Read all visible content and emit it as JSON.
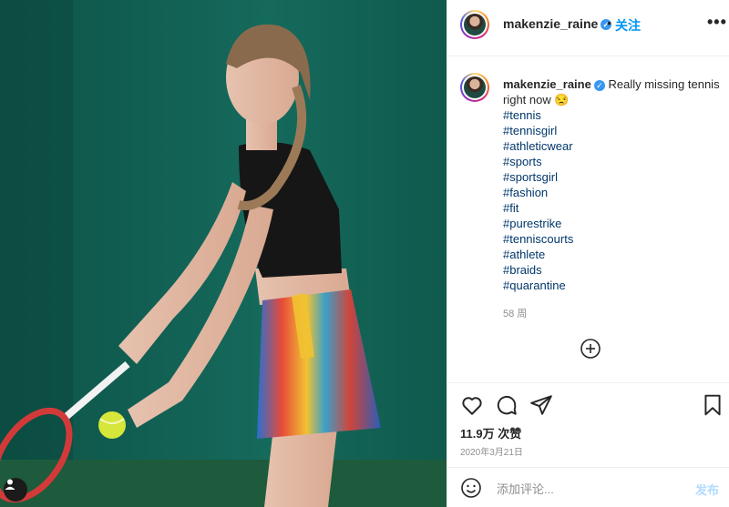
{
  "header": {
    "username": "makenzie_raine",
    "separator": "•",
    "follow_label": "关注",
    "more_label": "•••"
  },
  "caption": {
    "username": "makenzie_raine",
    "text": "Really missing tennis right now 😒",
    "hashtags": [
      "#tennis",
      "#tennisgirl",
      "#athleticwear",
      "#sports",
      "#sportsgirl",
      "#fashion",
      "#fit",
      "#purestrike",
      "#tenniscourts",
      "#athlete",
      "#braids",
      "#quarantine"
    ],
    "time_ago": "58 周"
  },
  "actions": {
    "likes": "11.9万 次赞",
    "date": "2020年3月21日"
  },
  "comment": {
    "placeholder": "添加评论...",
    "post_label": "发布"
  },
  "colors": {
    "accent": "#0095f6",
    "verified": "#3897f0",
    "hashtag": "#00376b",
    "muted": "#8e8e8e"
  }
}
